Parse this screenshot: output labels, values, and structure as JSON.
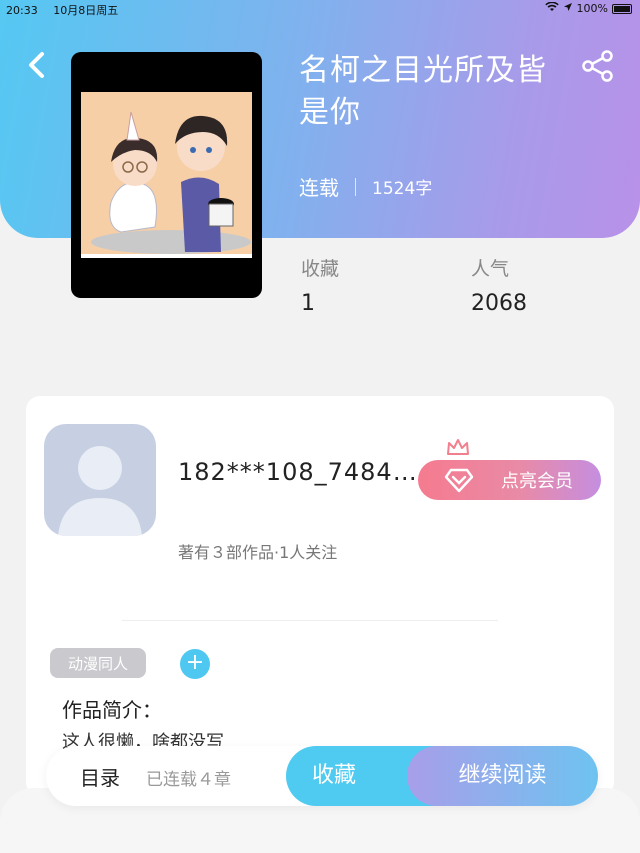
{
  "status_bar": {
    "time": "20:33",
    "date": "10月8日周五",
    "battery": "100%"
  },
  "book": {
    "title": "名柯之目光所及皆是你",
    "status": "连载",
    "word_count": "1524字"
  },
  "stats": {
    "favorites_label": "收藏",
    "favorites_value": "1",
    "popularity_label": "人气",
    "popularity_value": "2068"
  },
  "author": {
    "name": "182***108_74849...",
    "meta": "著有３部作品·1人关注",
    "vip_label": "点亮会员"
  },
  "tags": [
    "动漫同人"
  ],
  "add_tag_symbol": "+",
  "intro": {
    "title": "作品简介：",
    "text": "这人很懒，啥都没写"
  },
  "action_bar": {
    "toc_label": "目录",
    "toc_count": "已连载４章",
    "favorite_label": "收藏",
    "read_label": "继续阅读"
  },
  "icons": {
    "back": "chevron-left-icon",
    "share": "share-icon",
    "vip": "diamond-icon",
    "crown": "crown-icon"
  },
  "colors": {
    "gradient_start": "#55c8f2",
    "gradient_end": "#b891e8",
    "accent_blue": "#4fcaf1",
    "vip_pink": "#f57b8f"
  }
}
